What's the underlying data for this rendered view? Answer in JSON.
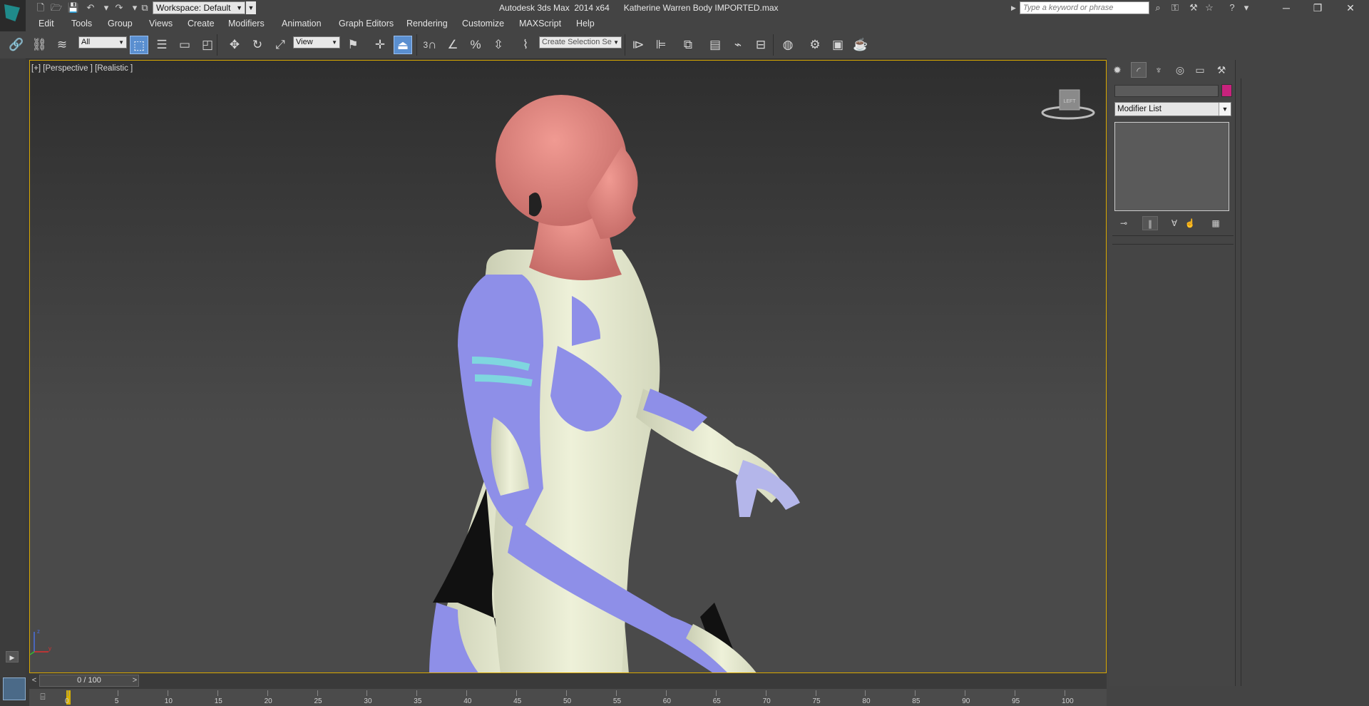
{
  "titlebar": {
    "workspace": "Workspace: Default",
    "title": "Autodesk 3ds Max  2014 x64      Katherine Warren Body IMPORTED.max",
    "search_placeholder": "Type a keyword or phrase"
  },
  "menu": [
    "Edit",
    "Tools",
    "Group",
    "Views",
    "Create",
    "Modifiers",
    "Animation",
    "Graph Editors",
    "Rendering",
    "Customize",
    "MAXScript",
    "Help"
  ],
  "toolbar": {
    "selection_filter": "All",
    "reference_coord": "View",
    "snap_toggle_label": "3",
    "named_selection_set": "Create Selection Se"
  },
  "viewport": {
    "label": "[+] [Perspective ] [Realistic ]",
    "viewcube_face": "LEFT"
  },
  "command_panel": {
    "modifier_list": "Modifier List",
    "object_color": "#c8237d"
  },
  "timeline": {
    "slider_label": "0 / 100",
    "current_frame": 0,
    "prev_label": "<",
    "next_label": ">",
    "ticks": [
      "0",
      "5",
      "10",
      "15",
      "20",
      "25",
      "30",
      "35",
      "40",
      "45",
      "50",
      "55",
      "60",
      "65",
      "70",
      "75",
      "80",
      "85",
      "90",
      "95",
      "100"
    ]
  },
  "colors": {
    "accent_active": "#5a8fd0",
    "viewport_border": "#d9a800",
    "skin": "#e18a84",
    "body_cream": "#e6ead0",
    "body_lavender": "#8e8fe8"
  }
}
